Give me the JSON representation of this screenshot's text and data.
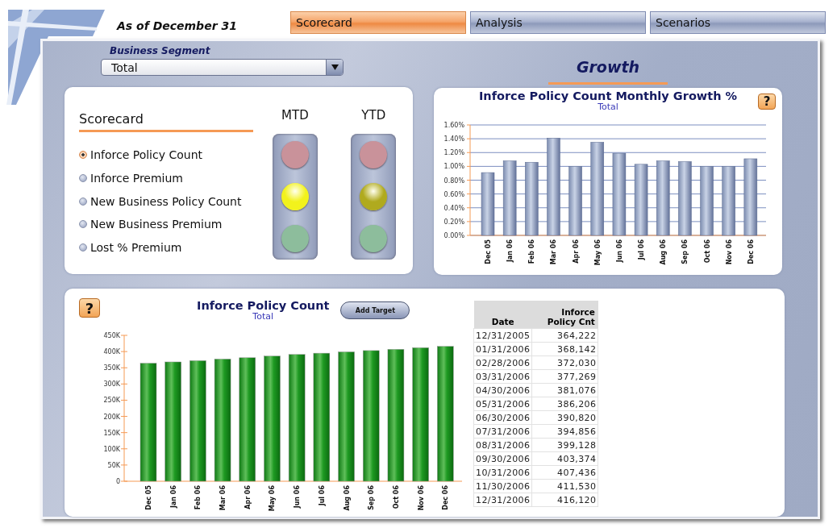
{
  "header": {
    "date_label": "As of December 31"
  },
  "tabs": [
    {
      "label": "Scorecard",
      "selected": true
    },
    {
      "label": "Analysis",
      "selected": false
    },
    {
      "label": "Scenarios",
      "selected": false
    }
  ],
  "segment": {
    "label": "Business Segment",
    "value": "Total"
  },
  "scorecard": {
    "title": "Scorecard",
    "items": [
      {
        "label": "Inforce Policy Count",
        "selected": true
      },
      {
        "label": "Inforce Premium",
        "selected": false
      },
      {
        "label": "New Business Policy Count",
        "selected": false
      },
      {
        "label": "New Business Premium",
        "selected": false
      },
      {
        "label": "Lost % Premium",
        "selected": false
      }
    ],
    "signals": [
      {
        "label": "MTD",
        "lamps": [
          {
            "on": false,
            "color": "#c9929a"
          },
          {
            "on": true,
            "color": "#f2f21c"
          },
          {
            "on": false,
            "color": "#8dbd9c"
          }
        ]
      },
      {
        "label": "YTD",
        "lamps": [
          {
            "on": false,
            "color": "#c9929a"
          },
          {
            "on": true,
            "color": "#b0aa1e"
          },
          {
            "on": false,
            "color": "#8dbd9c"
          }
        ]
      }
    ]
  },
  "growth": {
    "title": "Growth",
    "chart_data": {
      "type": "bar",
      "title": "Inforce Policy Count Monthly Growth %",
      "categories": [
        "Dec 05",
        "Jan 06",
        "Feb 06",
        "Mar 06",
        "Apr 06",
        "May 06",
        "Jun 06",
        "Jul 06",
        "Aug 06",
        "Sep 06",
        "Oct 06",
        "Nov 06",
        "Dec 06"
      ],
      "series": [
        {
          "name": "Total",
          "values": [
            0.91,
            1.08,
            1.06,
            1.41,
            1.0,
            1.35,
            1.19,
            1.03,
            1.08,
            1.07,
            1.0,
            1.0,
            1.11
          ]
        }
      ],
      "grid": true,
      "ylim": [
        0,
        1.6
      ],
      "yticks": [
        {
          "value": 0,
          "label": "0.00%"
        },
        {
          "value": 0.2,
          "label": "0.20%"
        },
        {
          "value": 0.4,
          "label": "0.40%"
        },
        {
          "value": 0.6,
          "label": "0.60%"
        },
        {
          "value": 0.8,
          "label": "0.80%"
        },
        {
          "value": 1.0,
          "label": "1.00%"
        },
        {
          "value": 1.2,
          "label": "1.20%"
        },
        {
          "value": 1.4,
          "label": "1.40%"
        },
        {
          "value": 1.6,
          "label": "1.60%"
        }
      ]
    },
    "help": "?"
  },
  "count": {
    "help": "?",
    "add_target": "Add Target",
    "chart_data": {
      "type": "bar",
      "title": "Inforce Policy Count",
      "categories": [
        "Dec 05",
        "Jan 06",
        "Feb 06",
        "Mar 06",
        "Apr 06",
        "May 06",
        "Jun 06",
        "Jul 06",
        "Aug 06",
        "Sep 06",
        "Oct 06",
        "Nov 06",
        "Dec 06"
      ],
      "series": [
        {
          "name": "Total",
          "values": [
            364000,
            368000,
            372000,
            377000,
            381000,
            386000,
            391000,
            395000,
            399000,
            403000,
            407000,
            412000,
            416000
          ]
        }
      ],
      "ylim": [
        0,
        450000
      ],
      "yticks": [
        {
          "value": 0,
          "label": "0"
        },
        {
          "value": 50000,
          "label": "50K"
        },
        {
          "value": 100000,
          "label": "100K"
        },
        {
          "value": 150000,
          "label": "150K"
        },
        {
          "value": 200000,
          "label": "200K"
        },
        {
          "value": 250000,
          "label": "250K"
        },
        {
          "value": 300000,
          "label": "300K"
        },
        {
          "value": 350000,
          "label": "350K"
        },
        {
          "value": 400000,
          "label": "400K"
        },
        {
          "value": 450000,
          "label": "450K"
        }
      ]
    },
    "table": {
      "columns": [
        "Date",
        "Inforce Policy Cnt"
      ],
      "rows": [
        [
          "12/31/2005",
          "364,222"
        ],
        [
          "01/31/2006",
          "368,142"
        ],
        [
          "02/28/2006",
          "372,030"
        ],
        [
          "03/31/2006",
          "377,269"
        ],
        [
          "04/30/2006",
          "381,076"
        ],
        [
          "05/31/2006",
          "386,206"
        ],
        [
          "06/30/2006",
          "390,820"
        ],
        [
          "07/31/2006",
          "394,856"
        ],
        [
          "08/31/2006",
          "399,128"
        ],
        [
          "09/30/2006",
          "403,374"
        ],
        [
          "10/31/2006",
          "407,436"
        ],
        [
          "11/30/2006",
          "411,530"
        ],
        [
          "12/31/2006",
          "416,120"
        ]
      ]
    }
  }
}
